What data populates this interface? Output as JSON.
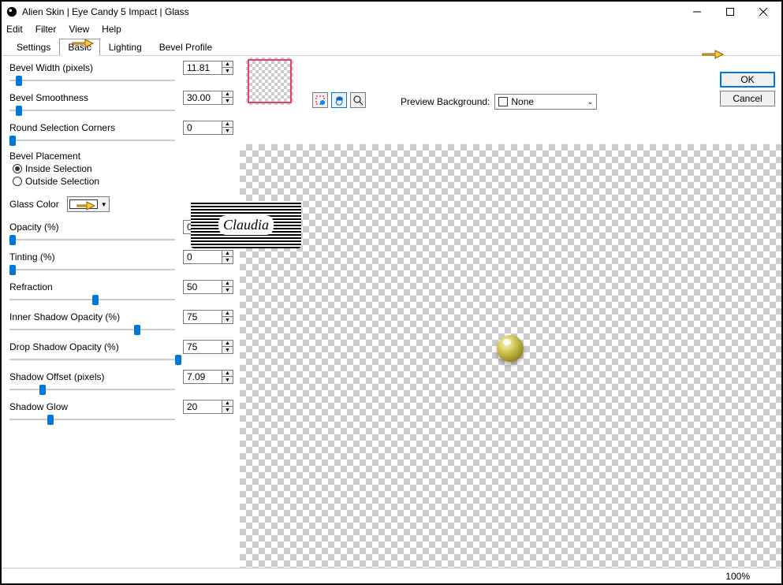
{
  "window": {
    "title": "Alien Skin | Eye Candy 5 Impact | Glass"
  },
  "menu": {
    "edit": "Edit",
    "filter": "Filter",
    "view": "View",
    "help": "Help"
  },
  "tabs": {
    "settings": "Settings",
    "basic": "Basic",
    "lighting": "Lighting",
    "bevel_profile": "Bevel Profile"
  },
  "buttons": {
    "ok": "OK",
    "cancel": "Cancel"
  },
  "preview": {
    "bg_label": "Preview Background:",
    "bg_value": "None"
  },
  "params": {
    "bevel_width": {
      "label": "Bevel Width (pixels)",
      "value": "11.81",
      "pos": 4
    },
    "bevel_smooth": {
      "label": "Bevel Smoothness",
      "value": "30.00",
      "pos": 4
    },
    "round_sel": {
      "label": "Round Selection Corners",
      "value": "0",
      "pos": 0
    },
    "bevel_placement": {
      "label": "Bevel Placement",
      "inside": "Inside Selection",
      "outside": "Outside Selection"
    },
    "glass_color": {
      "label": "Glass Color"
    },
    "opacity": {
      "label": "Opacity (%)",
      "value": "0",
      "pos": 0
    },
    "tinting": {
      "label": "Tinting (%)",
      "value": "0",
      "pos": 0
    },
    "refraction": {
      "label": "Refraction",
      "value": "50",
      "pos": 50
    },
    "inner_shadow": {
      "label": "Inner Shadow Opacity (%)",
      "value": "75",
      "pos": 75
    },
    "drop_shadow": {
      "label": "Drop Shadow Opacity (%)",
      "value": "75",
      "pos": 100
    },
    "shadow_offset": {
      "label": "Shadow Offset (pixels)",
      "value": "7.09",
      "pos": 18
    },
    "shadow_glow": {
      "label": "Shadow Glow",
      "value": "20",
      "pos": 23
    }
  },
  "watermark": "Claudia",
  "status": {
    "zoom": "100%"
  }
}
